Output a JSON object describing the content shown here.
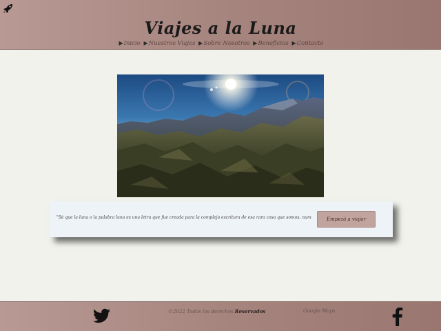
{
  "header": {
    "logo_icon": "rocket-icon",
    "title": "Viajes a la Luna",
    "nav": [
      {
        "label": "Inicio"
      },
      {
        "label": "Nuestros Viajes"
      },
      {
        "label": "Sobre Nosotros"
      },
      {
        "label": "Beneficios"
      },
      {
        "label": "Contacto"
      }
    ]
  },
  "hero": {
    "image": "moonscape-mountains-sun"
  },
  "quote": {
    "text": "\"Sé que la luna o la palabra luna es una letra que fue creada para la compleja escritura de esa rara cosa que somos, numerosa y uno\"",
    "button_label": "Empezá a viajar"
  },
  "footer": {
    "twitter_icon": "twitter-icon",
    "copyright_prefix": "©2022 Todos los derechos",
    "copyright_bold": "Reservados",
    "map_link": "Google Maps",
    "facebook_icon": "facebook-icon"
  },
  "colors": {
    "header_bg": "#a7857f",
    "page_bg": "#f2f2ec",
    "card_bg": "#eef3f7",
    "button_bg": "#c2a49f"
  }
}
